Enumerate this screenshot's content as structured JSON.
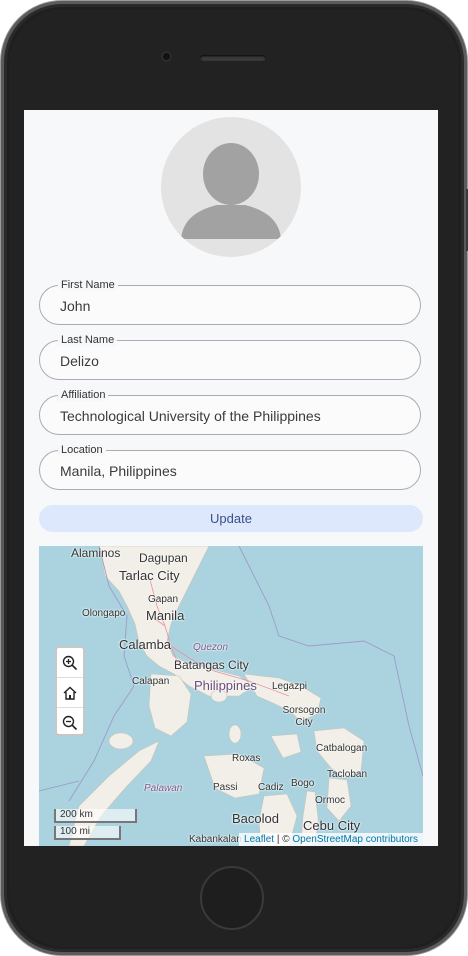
{
  "profile": {
    "fields": [
      {
        "label": "First Name",
        "value": "John"
      },
      {
        "label": "Last Name",
        "value": "Delizo"
      },
      {
        "label": "Affiliation",
        "value": "Technological University of the Philippines"
      },
      {
        "label": "Location",
        "value": "Manila, Philippines"
      }
    ],
    "update_label": "Update"
  },
  "map": {
    "places": [
      "Alaminos",
      "Dagupan",
      "Tarlac City",
      "Gapan",
      "Olongapo",
      "Manila",
      "Calamba",
      "Quezon",
      "Batangas City",
      "Calapan",
      "Philippines",
      "Legazpi",
      "Sorsogon City",
      "Catbalogan",
      "Roxas",
      "Tacloban",
      "Palawan",
      "Passi",
      "Cadiz",
      "Bogo",
      "Ormoc",
      "Bacolod",
      "Cebu City",
      "Kabankalan"
    ],
    "scale_km": "200 km",
    "scale_mi": "100 mi",
    "attribution": {
      "leaflet": "Leaflet",
      "separator": " | © ",
      "osm": "OpenStreetMap contributors"
    },
    "colors": {
      "water": "#aad3df",
      "land": "#f2efe9",
      "border": "#9e9ac8",
      "road": "#e892a2"
    }
  },
  "icons": {
    "zoom_in": "zoom-in-icon",
    "home": "home-icon",
    "zoom_out": "zoom-out-icon"
  }
}
